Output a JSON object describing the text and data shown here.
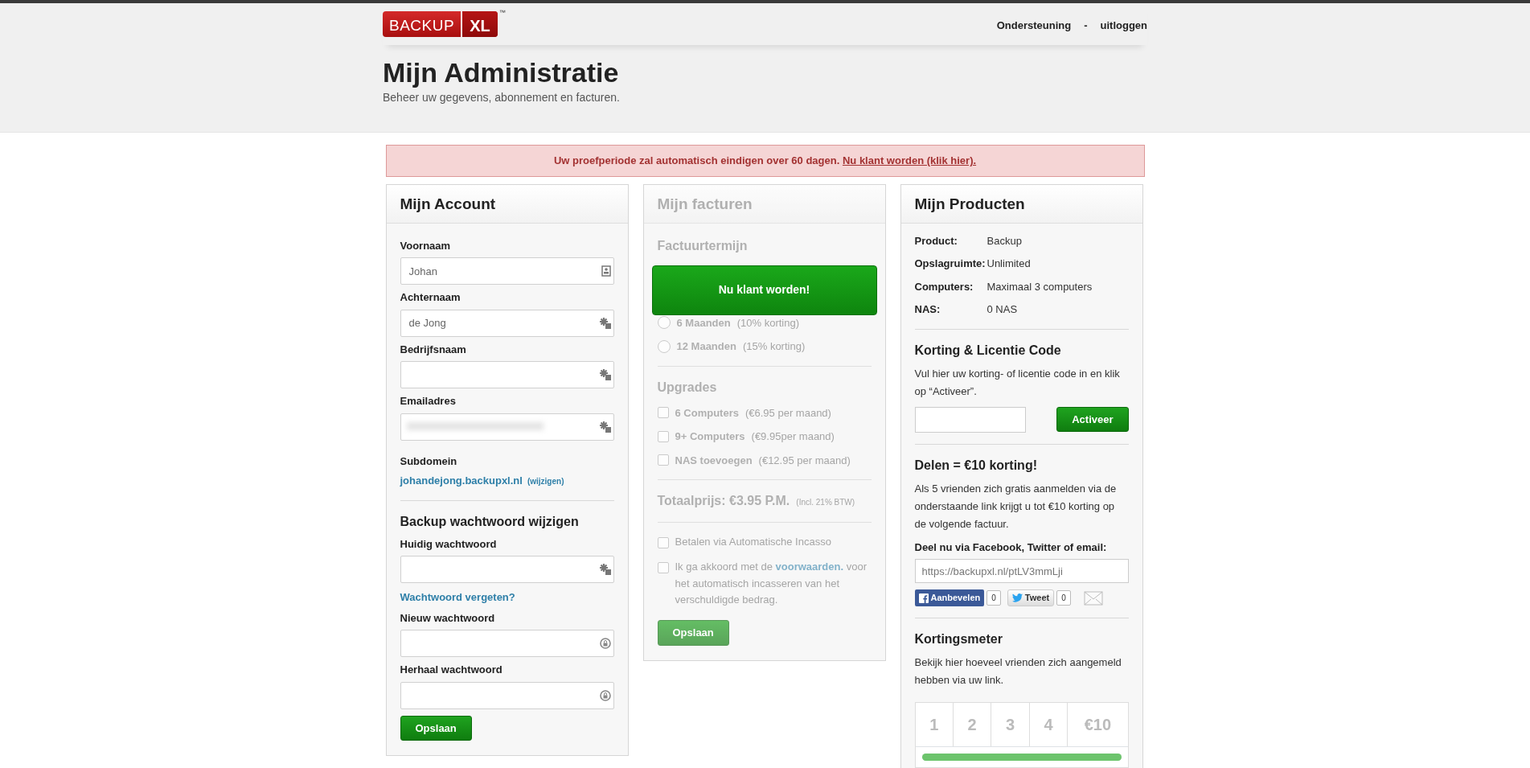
{
  "header": {
    "logo": {
      "word": "BACKUP",
      "badge": "XL",
      "trademark": "™"
    },
    "nav": {
      "links": [
        "Ondersteuning",
        "uitloggen"
      ],
      "separator": "-"
    }
  },
  "page": {
    "title": "Mijn Administratie",
    "subtitle": "Beheer uw gegevens, abonnement en facturen."
  },
  "alert": {
    "text": "Uw proefperiode zal automatisch eindigen over 60 dagen.",
    "link": "Nu klant worden (klik hier)."
  },
  "account": {
    "title": "Mijn Account",
    "fields": [
      {
        "label": "Voornaam",
        "value": "Johan",
        "kind": "contact"
      },
      {
        "label": "Achternaam",
        "value": "de Jong",
        "kind": "key"
      },
      {
        "label": "Bedrijfsnaam",
        "kind": "key"
      },
      {
        "label": "Emailadres",
        "kind": "key",
        "redacted": true
      }
    ],
    "subdomain": {
      "label": "Subdomein",
      "value": "johandejong.backupxl.nl",
      "change": "(wijzigen)"
    },
    "password": {
      "title": "Backup wachtwoord wijzigen",
      "fields": [
        {
          "label": "Huidig wachtwoord",
          "kind": "key",
          "link": "Wachtwoord vergeten?"
        },
        {
          "label": "Nieuw wachtwoord",
          "kind": "lock"
        },
        {
          "label": "Herhaal wachtwoord",
          "kind": "lock"
        }
      ]
    },
    "save": "Opslaan"
  },
  "invoices": {
    "title": "Mijn facturen",
    "disabled": true,
    "cta": "Nu klant worden!",
    "term_title": "Factuurtermijn",
    "terms": [
      {
        "label": "6 Maanden",
        "note": "(10% korting)",
        "selected": false
      },
      {
        "label": "12 Maanden",
        "note": "(15% korting)",
        "selected": false
      }
    ],
    "upgrades_title": "Upgrades",
    "upgrades": [
      {
        "label": "6 Computers",
        "note": "(€6.95 per maand)",
        "checked": false
      },
      {
        "label": "9+ Computers",
        "note": "(€9.95per maand)",
        "checked": false
      },
      {
        "label": "NAS toevoegen",
        "note": "(€12.95 per maand)",
        "checked": false
      }
    ],
    "total": {
      "label": "Totaalprijs: €3.95 P.M.",
      "note": "(Incl. 21% BTW)"
    },
    "agreements": [
      {
        "before": "Betalen via Automatische Incasso",
        "checked": false
      },
      {
        "before": "Ik ga akkoord met de",
        "link": "voorwaarden.",
        "after": "voor het automatisch incasseren van het verschuldigde bedrag.",
        "checked": false
      }
    ],
    "save": "Opslaan"
  },
  "products": {
    "title": "Mijn Producten",
    "specs": [
      {
        "label": "Product:",
        "value": "Backup"
      },
      {
        "label": "Opslagruimte:",
        "value": "Unlimited"
      },
      {
        "label": "Computers:",
        "value": "Maximaal 3 computers"
      },
      {
        "label": "NAS:",
        "value": "0 NAS"
      }
    ],
    "coupon": {
      "title": "Korting & Licentie Code",
      "text": "Vul hier uw korting- of licentie code in en klik op “Activeer”.",
      "button": "Activeer"
    },
    "share": {
      "title": "Delen = €10 korting!",
      "text": "Als 5 vrienden zich gratis aanmelden via de onderstaande link krijgt u tot €10 korting op de volgende factuur.",
      "prompt": "Deel nu via Facebook, Twitter of email:",
      "url": "https://backupxl.nl/ptLV3mmLji",
      "facebook": {
        "label": "Aanbevelen",
        "count": "0"
      },
      "twitter": {
        "label": "Tweet",
        "count": "0"
      }
    },
    "meter": {
      "title": "Kortingsmeter",
      "text": "Bekijk hier hoeveel vrienden zich aangemeld hebben via uw link.",
      "steps": [
        "1",
        "2",
        "3",
        "4",
        "€10"
      ],
      "level": 1
    }
  }
}
